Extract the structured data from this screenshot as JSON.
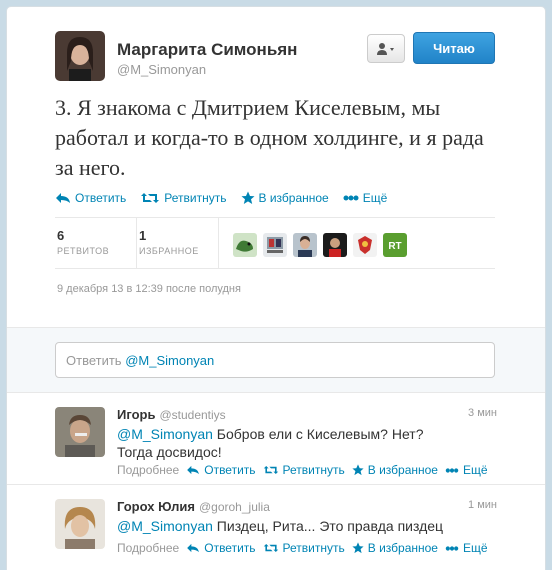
{
  "tweet": {
    "author_name": "Маргарита Симоньян",
    "author_handle": "@M_Simonyan",
    "follow_label": "Читаю",
    "text": "3. Я знакома с Дмитрием Киселевым, мы работал и когда-то в одном холдинге, и я рада за него.",
    "actions": {
      "reply": "Ответить",
      "retweet": "Ретвитнуть",
      "favorite": "В избранное",
      "more": "Ещё"
    },
    "stats": {
      "retweets_count": "6",
      "retweets_label": "РЕТВИТОВ",
      "favorites_count": "1",
      "favorites_label": "ИЗБРАННОЕ"
    },
    "date": "9 декабря 13 в 12:39 после полудня"
  },
  "reply_box": {
    "placeholder_prefix": "Ответить",
    "mention": "@M_Simonyan"
  },
  "replies": [
    {
      "name": "Игорь",
      "handle": "@studentiys",
      "time": "3 мин",
      "mention": "@M_Simonyan",
      "text": " Бобров ели с Киселевым? Нет? Тогда досвидос!",
      "more_label": "Подробнее",
      "reply": "Ответить",
      "retweet": "Ретвитнуть",
      "favorite": "В избранное",
      "more": "Ещё"
    },
    {
      "name": "Горох Юлия",
      "handle": "@goroh_julia",
      "time": "1 мин",
      "mention": "@M_Simonyan",
      "text": " Пиздец, Рита... Это правда пиздец",
      "more_label": "Подробнее",
      "reply": "Ответить",
      "retweet": "Ретвитнуть",
      "favorite": "В избранное",
      "more": "Ещё"
    }
  ],
  "colors": {
    "link": "#0084b4",
    "follow_button": "#2183c8",
    "favorite_star": "#2aa198"
  }
}
